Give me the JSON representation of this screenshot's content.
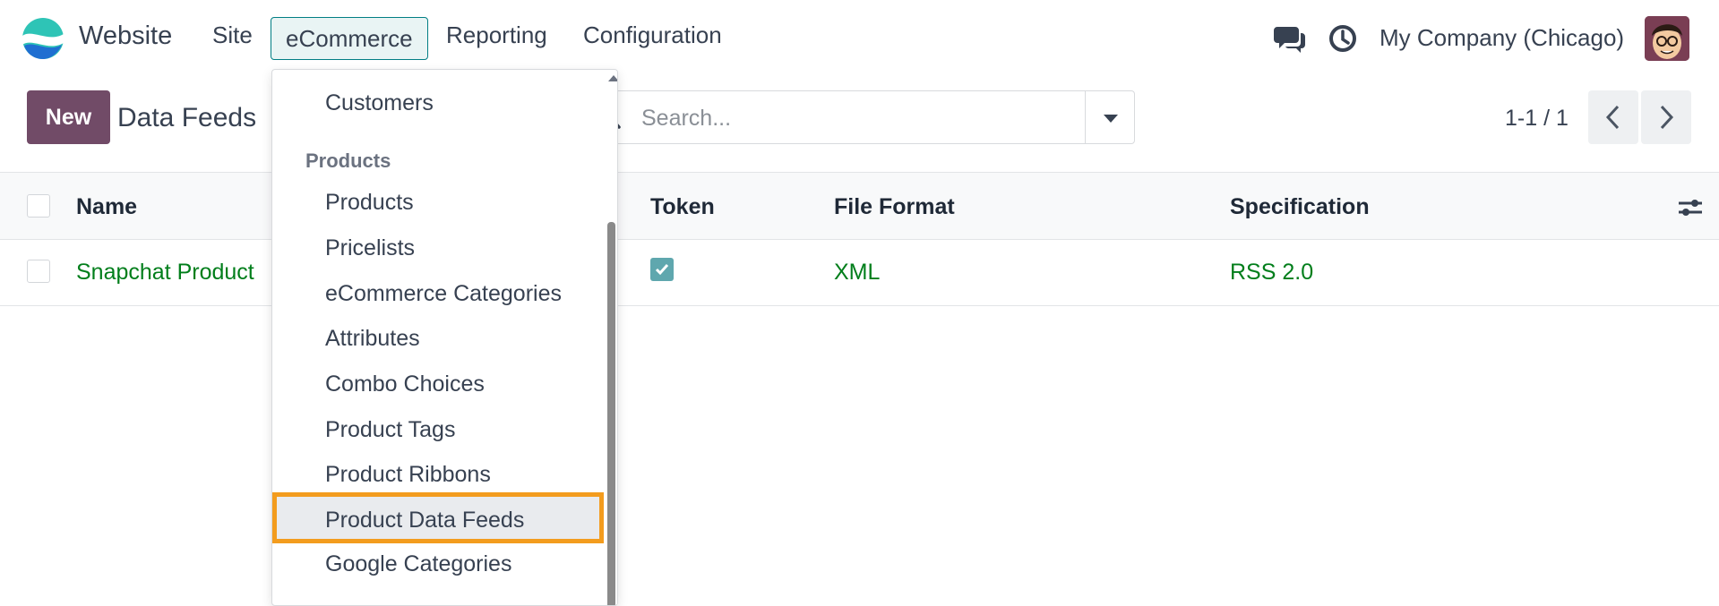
{
  "navbar": {
    "app_name": "Website",
    "menu": [
      {
        "label": "Site"
      },
      {
        "label": "eCommerce"
      },
      {
        "label": "Reporting"
      },
      {
        "label": "Configuration"
      }
    ],
    "company": "My Company (Chicago)",
    "icons": [
      "chat-icon",
      "clock-icon"
    ]
  },
  "control_panel": {
    "new_button": "New",
    "breadcrumb": "Data Feeds",
    "search_placeholder": "Search...",
    "pager": "1-1 / 1"
  },
  "list": {
    "columns": [
      "Name",
      "Token",
      "File Format",
      "Specification"
    ],
    "rows": [
      {
        "name": "Snapchat Product",
        "token": true,
        "file_format": "XML",
        "specification": "RSS 2.0"
      }
    ]
  },
  "dropdown": {
    "items_top": [
      "Customers"
    ],
    "section_header": "Products",
    "items": [
      "Products",
      "Pricelists",
      "eCommerce Categories",
      "Attributes",
      "Combo Choices",
      "Product Tags",
      "Product Ribbons",
      "Product Data Feeds",
      "Google Categories"
    ],
    "highlighted": "Product Data Feeds"
  },
  "colors": {
    "brand": "#714b67",
    "accent": "#017e84",
    "link_green": "#017e1b",
    "highlight_border": "#f39c1e"
  }
}
